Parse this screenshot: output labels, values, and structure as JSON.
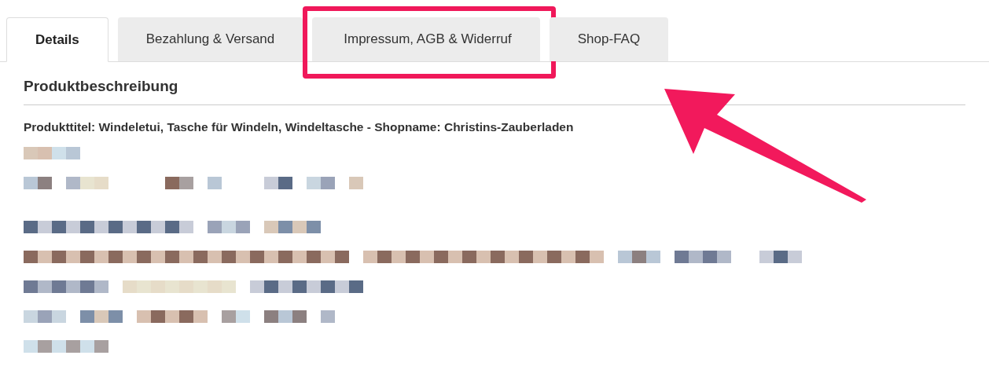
{
  "tabs": [
    {
      "label": "Details",
      "selected": true,
      "highlighted": false
    },
    {
      "label": "Bezahlung & Versand",
      "selected": false,
      "highlighted": false
    },
    {
      "label": "Impressum, AGB & Widerruf",
      "selected": false,
      "highlighted": true
    },
    {
      "label": "Shop-FAQ",
      "selected": false,
      "highlighted": false
    }
  ],
  "section": {
    "heading": "Produktbeschreibung",
    "title_line": "Produkttitel: Windeletui, Tasche für Windeln, Windeltasche - Shopname: Christins-Zauberladen"
  }
}
